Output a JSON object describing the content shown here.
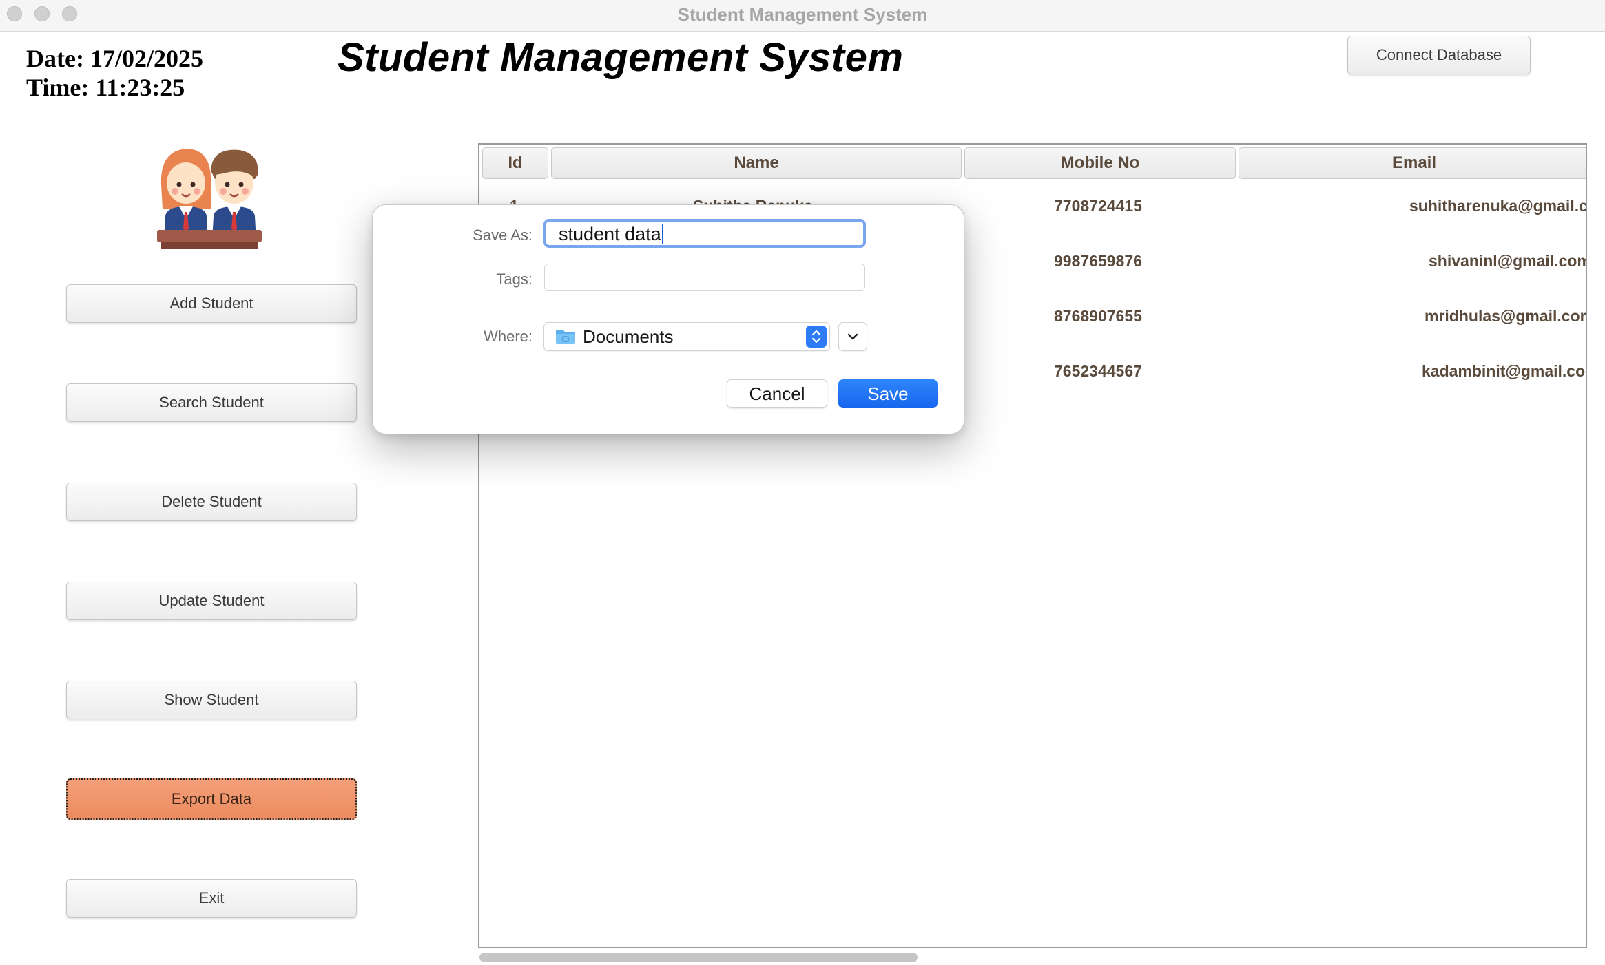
{
  "window": {
    "title": "Student Management System"
  },
  "header": {
    "date_text": "Date: 17/02/2025",
    "time_text": "Time: 11:23:25",
    "app_title": "Student Management System",
    "connect_button": "Connect Database"
  },
  "sidebar": {
    "avatar_icon": "students-avatar-icon",
    "buttons": [
      "Add Student",
      "Search Student",
      "Delete Student",
      "Update Student",
      "Show Student",
      "Export Data",
      "Exit"
    ],
    "active_button": "Export Data",
    "active_color": "#ef915f"
  },
  "table": {
    "columns": [
      "Id",
      "Name",
      "Mobile No",
      "Email"
    ],
    "rows": [
      {
        "id": "1",
        "name": "Suhitha Renuka",
        "mobile": "7708724415",
        "email": "suhitharenuka@gmail.com"
      },
      {
        "id": "",
        "name": "",
        "mobile": "9987659876",
        "email": "shivaninl@gmail.com"
      },
      {
        "id": "",
        "name": "",
        "mobile": "8768907655",
        "email": "mridhulas@gmail.com"
      },
      {
        "id": "",
        "name": "",
        "mobile": "7652344567",
        "email": "kadambinit@gmail.com"
      }
    ]
  },
  "save_dialog": {
    "save_as_label": "Save As:",
    "save_as_value": "student data",
    "tags_label": "Tags:",
    "tags_value": "",
    "where_label": "Where:",
    "where_value": "Documents",
    "cancel_label": "Cancel",
    "save_label": "Save",
    "accent_color": "#1f6ff2"
  }
}
